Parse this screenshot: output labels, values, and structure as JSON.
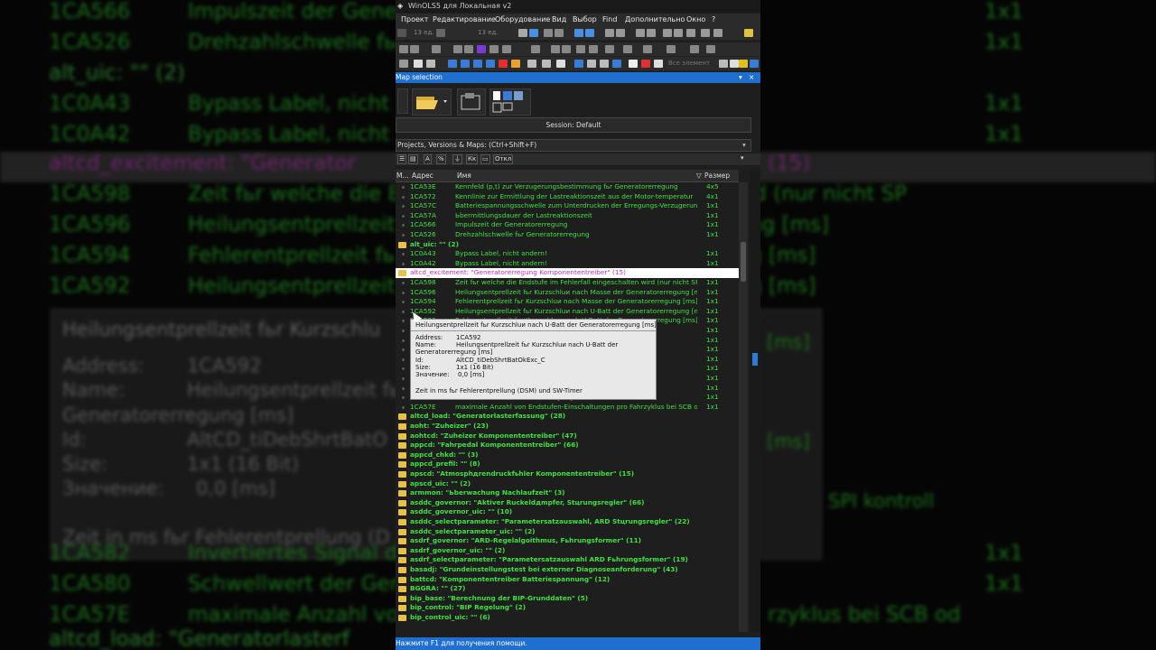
{
  "window": {
    "title": "WinOLS5 для Локальная v2",
    "menu": [
      "Проект",
      "Редактирование",
      "Оборудование",
      "Вид",
      "Выбор",
      "Find",
      "Дополнительно",
      "Окно",
      "?"
    ],
    "toolbar_text": {
      "units1": "13 ед.",
      "units2": "13 ед.",
      "all_elements": "Все элемент"
    }
  },
  "panel": {
    "title": "Map selection",
    "pin_icon": "▾",
    "close_icon": "×",
    "session": "Session: Default",
    "projects_label": "Projects, Versions & Maps:  (Ctrl+Shift+F)",
    "filter_buttons": [
      "A",
      "%",
      "Кк",
      "Откл"
    ]
  },
  "columns": {
    "m": "M...",
    "address": "Адрес",
    "name": "Имя",
    "size": "Размер"
  },
  "rows": [
    {
      "type": "item",
      "address": "1CA53E",
      "name": "Kennfeld (p,t) zur Verzugerungsbestimmung fьr Generatorerregung",
      "size": "4x5"
    },
    {
      "type": "item",
      "address": "1CA572",
      "name": "Kennlinie zur Ermittlung der Lastreaktionszeit aus der Motor-temperatur",
      "size": "4x1"
    },
    {
      "type": "item",
      "address": "1CA57C",
      "name": "Batteriespannungsschwelle zum Unterdrucken der Erregungs-Verzцgerung",
      "size": "1x1"
    },
    {
      "type": "item",
      "address": "1CA57A",
      "name": "Ьbermittlungsdauer der Lastreaktionszeit",
      "size": "1x1"
    },
    {
      "type": "item",
      "address": "1CA566",
      "name": "Impulszeit der Generatorerregung",
      "size": "1x1"
    },
    {
      "type": "item",
      "address": "1CA526",
      "name": "Drehzahlschwelle fьr Generatorerregung",
      "size": "1x1"
    },
    {
      "type": "folder",
      "label": "alt_uic: \"\" (2)"
    },
    {
      "type": "item",
      "address": "1C0A43",
      "name": "Bypass Label, nicht andern!",
      "size": "1x1"
    },
    {
      "type": "item",
      "address": "1C0A42",
      "name": "Bypass Label, nicht andern!",
      "size": "1x1"
    },
    {
      "type": "folder",
      "label": "altcd_excitement: \"Generatorerregung Komponententreiber\" (15)",
      "highlight": true
    },
    {
      "type": "item",
      "address": "1CA598",
      "name": "Zeit fьr welche die Endstufe im Fehlerfall eingeschalten wird (nur nicht SP",
      "size": "1x1"
    },
    {
      "type": "item",
      "address": "1CA596",
      "name": "Heilungsentprellzeit fьr Kurzschluи nach Masse der Generatorerregung [ms]",
      "size": "1x1"
    },
    {
      "type": "item",
      "address": "1CA594",
      "name": "Fehlerentprellzeit fьr Kurzschluи nach Masse der Generatorerregung [ms]",
      "size": "1x1"
    },
    {
      "type": "item",
      "address": "1CA592",
      "name": "Heilungsentprellzeit fьr Kurzschluи nach U-Batt der Generatorerregung [ms]",
      "size": "1x1"
    },
    {
      "type": "item",
      "address": "1CA590",
      "name": "Fehlerentprellzeit fьr Kurzschluи nach U-Batt der Generatorerregung [ms]",
      "size": "1x1"
    },
    {
      "type": "item",
      "address": "",
      "name": "",
      "size": "1x1"
    },
    {
      "type": "item",
      "address": "",
      "name": "",
      "size": "1x1"
    },
    {
      "type": "item",
      "address": "",
      "name": "",
      "size": "1x1"
    },
    {
      "type": "item",
      "address": "",
      "name": "",
      "size": "1x1"
    },
    {
      "type": "item",
      "address": "",
      "name": "SPI kontroll",
      "size": "1x1"
    },
    {
      "type": "item",
      "address": "",
      "name": "",
      "size": "1x1"
    },
    {
      "type": "item",
      "address": "1CA582",
      "name": "Invertiertes Signal der Generatorerregung",
      "size": "1x1"
    },
    {
      "type": "item",
      "address": "1CA580",
      "name": "Schwellwert der Generatorerregung",
      "size": "1x1"
    },
    {
      "type": "item",
      "address": "1CA57E",
      "name": "maximale Anzahl von Endstufen-Einschaltungen pro Fahrzyklus bei SCB od",
      "size": "1x1"
    },
    {
      "type": "folder",
      "label": "altcd_load: \"Generatorlasterfassung\" (28)"
    },
    {
      "type": "folder",
      "label": "aoht: \"Zuheizer\" (23)"
    },
    {
      "type": "folder",
      "label": "aohtcd: \"Zuheizer Komponententreiber\" (47)"
    },
    {
      "type": "folder",
      "label": "appcd: \"Fahrpedal Komponententreiber\" (66)"
    },
    {
      "type": "folder",
      "label": "appcd_chkd: \"\" (3)"
    },
    {
      "type": "folder",
      "label": "appcd_prefil: \"\" (8)"
    },
    {
      "type": "folder",
      "label": "apscd: \"Atmosphдrendruckfьhler Komponententreiber\" (15)"
    },
    {
      "type": "folder",
      "label": "apscd_uic: \"\" (2)"
    },
    {
      "type": "folder",
      "label": "armmon: \"Ьberwachung Nachlaufzeit\" (3)"
    },
    {
      "type": "folder",
      "label": "asddc_governor: \"Aktiver Ruckeldдmpfer, Stцrungsregler\" (66)"
    },
    {
      "type": "folder",
      "label": "asddc_governor_uic: \"\" (10)"
    },
    {
      "type": "folder",
      "label": "asddc_selectparameter: \"Parametersatzauswahl, ARD Stцrungsregler\" (22)"
    },
    {
      "type": "folder",
      "label": "asddc_selectparameter_uic: \"\" (2)"
    },
    {
      "type": "folder",
      "label": "asdrf_governor: \"ARD-Regelalgoithmus, Fьhrungsformer\" (11)"
    },
    {
      "type": "folder",
      "label": "asdrf_governor_uic: \"\" (2)"
    },
    {
      "type": "folder",
      "label": "asdrf_selectparameter: \"Parametersatzauswahl ARD Fьhrungsformer\" (19)"
    },
    {
      "type": "folder",
      "label": "basadj: \"Grundeinstellungstest bei externer Diagnoseanforderung\" (43)"
    },
    {
      "type": "folder",
      "label": "battcd: \"Komponententreiber Batteriespannung\" (12)"
    },
    {
      "type": "folder",
      "label": "BGGRA: \"\" (27)"
    },
    {
      "type": "folder",
      "label": "bip_base: \"Berechnung der BIP-Grunddaten\" (5)"
    },
    {
      "type": "folder",
      "label": "bip_control: \"BIP Regelung\" (2)"
    },
    {
      "type": "folder",
      "label": "bip_control_uic: \"\" (6)"
    }
  ],
  "tooltip": {
    "title": "Heilungsentprellzeit fьr Kurzschluи nach U-Batt der Generatorerregung [ms]",
    "address_label": "Address:",
    "address": "1CA592",
    "name_label": "Name:",
    "name1": "Heilungsentprellzeit fьr Kurzschluи nach U-Batt der",
    "name2": "Generatorerregung [ms]",
    "id_label": "Id:",
    "id": "AltCD_tiDebShrtBatOkExc_C",
    "size_label": "Size:",
    "size": "1x1 (16 Bit)",
    "value_label": "Значение:",
    "value": "0,0 [ms]",
    "description": "Zeit in ms fьr Fehlerentprellung (DSM) und SW-Timer"
  },
  "background": {
    "rows": [
      {
        "a": "1CA566",
        "n": "Impulszeit der Generat",
        "s": "1x1"
      },
      {
        "a": "1CA526",
        "n": "Drehzahlschwelle fьr",
        "s": "1x1"
      },
      {
        "a": "alt_uic: \"\" (2)",
        "n": "",
        "s": "",
        "folder": true
      },
      {
        "a": "1C0A43",
        "n": "Bypass Label, nicht",
        "s": "1x1"
      },
      {
        "a": "1C0A42",
        "n": "Bypass Label, nicht",
        "s": "1x1"
      },
      {
        "a": "altcd_excitement: \"Generator",
        "n": "",
        "s": "(15)",
        "hl": true
      },
      {
        "a": "1CA598",
        "n": "Zeit fьr welche die E",
        "s": "wird (nur nicht SP"
      },
      {
        "a": "1CA596",
        "n": "Heilungsentprellzeit",
        "s": "gung [ms]"
      },
      {
        "a": "1CA594",
        "n": "Fehlerentprellzeit fь",
        "s": "ung [ms]"
      },
      {
        "a": "1CA592",
        "n": "Heilungsentprellzeit",
        "s": "ung [ms]"
      }
    ],
    "rows_bottom": [
      {
        "a": "1CA582",
        "n": "Invertiertes Signal der",
        "s": "1x1"
      },
      {
        "a": "1CA580",
        "n": "Schwellwert der Gener",
        "s": "1x1"
      },
      {
        "a": "1CA57E",
        "n": "maximale Anzahl vo",
        "s": "rzyklus bei SCB od"
      }
    ],
    "tip": {
      "title": "Heilungsentprellzeit fьr Kurzschlu",
      "address_label": "Address:",
      "address": "1CA592",
      "name_label": "Name:",
      "name": "Heilungsentprellzeit fь",
      "name2": "Generatorerregung [ms]",
      "id_label": "Id:",
      "id": "AltCD_tiDebShrtBatO",
      "size_label": "Size:",
      "size": "1x1 (16 Bit)",
      "value_label": "Значение:",
      "value": "0,0 [ms]",
      "desc": "Zeit in ms fьr Fehlerentprellung (D",
      "right1": "[ms]",
      "right2": "[ms]",
      "right3": "SPI kontroll"
    },
    "bottom_folder": "altcd_load: \"Generatorlasterf"
  },
  "statusbar": "Нажмите F1 для получения помощи."
}
